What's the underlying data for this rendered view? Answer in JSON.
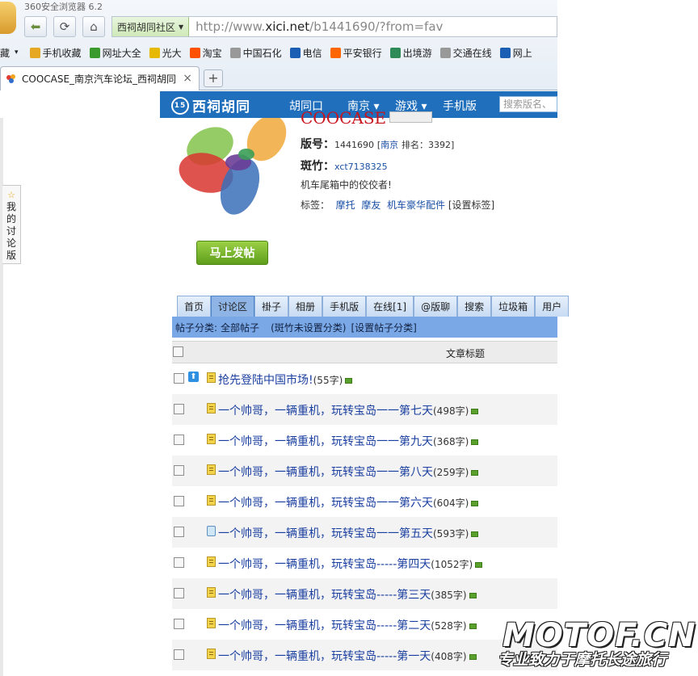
{
  "browser": {
    "title": "360安全浏览器 6.2",
    "address_dropdown": "西祠胡同社区",
    "url_prefix": "http://www.",
    "url_host": "xici.net",
    "url_path": "/b1441690/?from=fav",
    "bookmarks": [
      {
        "label": "藏",
        "icon": "bookmark-folder-icon",
        "color": "#e6a822"
      },
      {
        "label": "手机收藏",
        "icon": "folder-icon",
        "color": "#e6a822"
      },
      {
        "label": "网址大全",
        "icon": "compass-icon",
        "color": "#3a9a2e"
      },
      {
        "label": "光大",
        "icon": "everbright-icon",
        "color": "#e6b800"
      },
      {
        "label": "淘宝",
        "icon": "taobao-icon",
        "color": "#ff5000"
      },
      {
        "label": "中国石化",
        "icon": "page-icon",
        "color": "#999999"
      },
      {
        "label": "电信",
        "icon": "telecom-icon",
        "color": "#1a5fb4"
      },
      {
        "label": "平安银行",
        "icon": "pingan-icon",
        "color": "#ff6600"
      },
      {
        "label": "出境游",
        "icon": "travel-icon",
        "color": "#2e8b57"
      },
      {
        "label": "交通在线",
        "icon": "page-icon",
        "color": "#999999"
      },
      {
        "label": "网上",
        "icon": "bank-icon",
        "color": "#1a5fb4"
      }
    ],
    "tab_title": "COOCASE_南京汽车论坛_西祠胡同",
    "tab_close": "×",
    "new_tab": "+"
  },
  "site_nav": {
    "logo_badge": "15",
    "logo_text": "西祠胡同",
    "links": [
      {
        "label": "胡同口"
      },
      {
        "label": "南京 ▾"
      },
      {
        "label": "游戏 ▾"
      },
      {
        "label": "手机版"
      }
    ],
    "search_placeholder": "搜索版名、"
  },
  "sidebar": {
    "star": "☆",
    "label": "我的讨论版"
  },
  "board": {
    "title": "COOCASE",
    "id_label": "版号：",
    "id_value": "1441690",
    "city": "南京",
    "rank_label": "排名：",
    "rank_value": "3392",
    "moderator_label": "斑竹：",
    "moderator": "xct7138325",
    "slogan": "机车尾箱中的佼佼者!",
    "tags_label": "标签：",
    "tags": [
      "摩托",
      "摩友",
      "机车豪华配件"
    ],
    "set_tags": "[设置标签]",
    "post_button": "马上发帖"
  },
  "tabs": [
    "首页",
    "讨论区",
    "褂子",
    "相册",
    "手机版",
    "在线[1]",
    "@版聊",
    "搜索",
    "垃圾箱",
    "用户"
  ],
  "category": {
    "label": "帖子分类:",
    "all": "全部帖子",
    "unset": "(斑竹未设置分类)",
    "set": "[设置帖子分类]"
  },
  "table": {
    "header": "文章标题",
    "rows": [
      {
        "title": "抢先登陆中国市场!",
        "count": "(55字)",
        "pinned": true,
        "icon": "doc"
      },
      {
        "title": "一个帅哥，一辆重机，玩转宝岛一一第七天",
        "count": "(498字)",
        "pinned": false,
        "icon": "doc"
      },
      {
        "title": "一个帅哥，一辆重机，玩转宝岛一一第九天",
        "count": "(368字)",
        "pinned": false,
        "icon": "doc"
      },
      {
        "title": "一个帅哥，一辆重机，玩转宝岛一一第八天",
        "count": "(259字)",
        "pinned": false,
        "icon": "doc"
      },
      {
        "title": "一个帅哥，一辆重机，玩转宝岛一一第六天",
        "count": "(604字)",
        "pinned": false,
        "icon": "doc"
      },
      {
        "title": "一个帅哥，一辆重机，玩转宝岛一一第五天",
        "count": "(593字)",
        "pinned": false,
        "icon": "phone"
      },
      {
        "title": "一个帅哥，一辆重机，玩转宝岛-----第四天",
        "count": "(1052字)",
        "pinned": false,
        "icon": "doc"
      },
      {
        "title": "一个帅哥，一辆重机，玩转宝岛-----第三天",
        "count": "(385字)",
        "pinned": false,
        "icon": "doc"
      },
      {
        "title": "一个帅哥，一辆重机，玩转宝岛-----第二天",
        "count": "(528字)",
        "pinned": false,
        "icon": "doc"
      },
      {
        "title": "一个帅哥，一辆重机，玩转宝岛-----第一天",
        "count": "(408字)",
        "pinned": false,
        "icon": "doc"
      }
    ]
  },
  "watermark": {
    "main": "MOTOF.CN",
    "sub": "专业致力于摩托长途旅行"
  }
}
